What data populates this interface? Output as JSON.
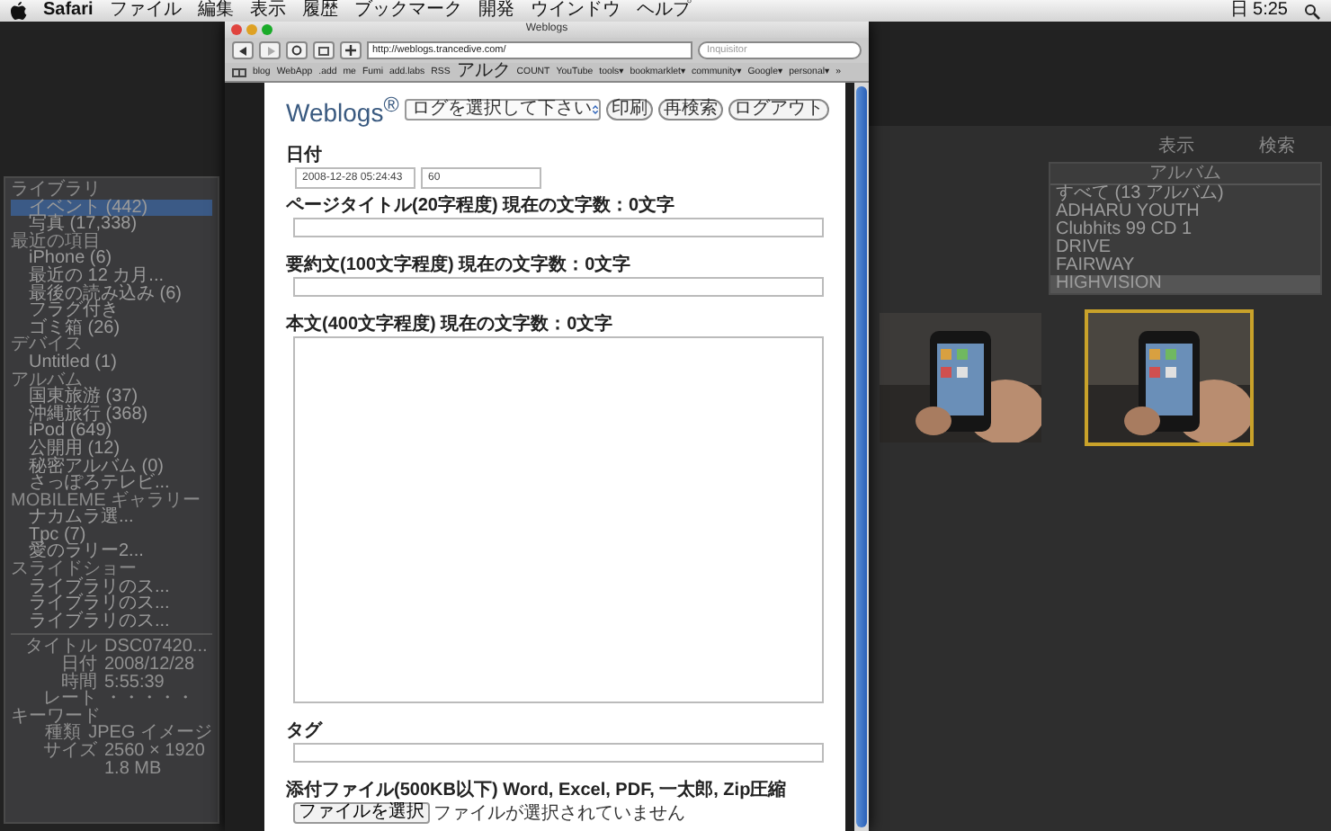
{
  "menu_bar": {
    "app": "Safari",
    "items": [
      "ファイル",
      "編集",
      "表示",
      "履歴",
      "ブックマーク",
      "開発",
      "ウインドウ",
      "ヘルプ"
    ],
    "clock": "日 5:25"
  },
  "browser": {
    "title": "Weblogs",
    "url": "http://weblogs.trancedive.com/",
    "search_placeholder": "Inquisitor",
    "bookmarks": [
      "blog",
      "WebApp",
      ".add",
      "me",
      "Fumi",
      "add.labs",
      "RSS",
      "アルク",
      "COUNT",
      "YouTube",
      "tools▾",
      "bookmarklet▾",
      "community▾",
      "Google▾",
      "personal▾",
      "»"
    ]
  },
  "page": {
    "logo": "Weblogs$^{®}$",
    "log_select": "ログを選択して下さい",
    "buttons": [
      "印刷",
      "再検索",
      "ログアウト"
    ],
    "date_label": "日付",
    "date_value": "2008-12-28 05:24:43",
    "minutes_value": "60",
    "fields": [
      {
        "label": "ページタイトル(20字程度) 現在の文字数：0文字",
        "kind": "input"
      },
      {
        "label": "要約文(100文字程度) 現在の文字数：0文字",
        "kind": "input"
      },
      {
        "label": "本文(400文字程度) 現在の文字数：0文字",
        "kind": "textarea"
      },
      {
        "label": "タグ",
        "kind": "input"
      }
    ],
    "attachment": {
      "label": "添付ファイル(500KB以下) Word, Excel, PDF, 一太郎, Zip圧縮",
      "button": "ファイルを選択",
      "status": "ファイルが選択されていません"
    }
  },
  "photo_library": {
    "sections": [
      {
        "title": "ライブラリ",
        "items": [
          {
            "label": "イベント (442)",
            "selected": true
          },
          {
            "label": "写真 (17,338)",
            "selected": false
          }
        ]
      },
      {
        "title": "最近の項目",
        "items": [
          {
            "label": "iPhone (6)",
            "selected": false
          },
          {
            "label": "最近の 12 カ月...",
            "selected": false
          },
          {
            "label": "最後の読み込み (6)",
            "selected": false
          },
          {
            "label": "フラグ付き",
            "selected": false
          },
          {
            "label": "ゴミ箱 (26)",
            "selected": false
          }
        ]
      },
      {
        "title": "デバイス",
        "items": [
          {
            "label": "Untitled (1)",
            "selected": false
          }
        ]
      },
      {
        "title": "アルバム",
        "items": [
          {
            "label": "国東旅游 (37)",
            "selected": false
          },
          {
            "label": "沖縄旅行 (368)",
            "selected": false
          },
          {
            "label": "iPod (649)",
            "selected": false
          },
          {
            "label": "公開用 (12)",
            "selected": false
          },
          {
            "label": "秘密アルバム (0)",
            "selected": false
          },
          {
            "label": "さっぽろテレビ...",
            "selected": false
          }
        ]
      },
      {
        "title": "MOBILEME ギャラリー",
        "items": [
          {
            "label": "ナカムラ選...",
            "selected": false
          },
          {
            "label": "Tpc (7)",
            "selected": false
          },
          {
            "label": "愛のラリー2...",
            "selected": false
          }
        ]
      },
      {
        "title": "スライドショー",
        "items": [
          {
            "label": "ライブラリのス...",
            "selected": false
          },
          {
            "label": "ライブラリのス...",
            "selected": false
          },
          {
            "label": "ライブラリのス...",
            "selected": false
          }
        ]
      }
    ],
    "info": [
      {
        "key": "タイトル",
        "value": "DSC07420..."
      },
      {
        "key": "日付",
        "value": "2008/12/28"
      },
      {
        "key": "時間",
        "value": "5:55:39"
      },
      {
        "key": "レート",
        "value": "・・・・・"
      },
      {
        "key": "キーワード"
      },
      {
        "key": "種類",
        "value": "JPEG イメージ"
      },
      {
        "key": "サイズ",
        "value": "2560 × 1920"
      },
      {
        "value": "1.8 MB"
      }
    ],
    "view_label": "表示",
    "search_label": "検索",
    "album_header": "アルバム",
    "albums": [
      {
        "label": "すべて (13 アルバム)",
        "selected": false
      },
      {
        "label": "ADHARU YOUTH",
        "selected": false
      },
      {
        "label": "Clubhits 99 CD 1",
        "selected": false
      },
      {
        "label": "DRIVE",
        "selected": false
      },
      {
        "label": "FAIRWAY",
        "selected": false
      },
      {
        "label": "HIGHVISION",
        "selected": true
      }
    ]
  }
}
